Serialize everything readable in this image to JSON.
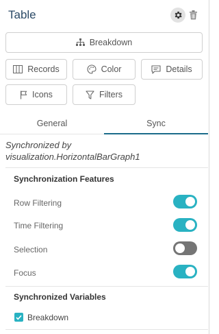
{
  "header": {
    "title": "Table"
  },
  "buttons": {
    "breakdown": "Breakdown",
    "records": "Records",
    "color": "Color",
    "details": "Details",
    "icons": "Icons",
    "filters": "Filters"
  },
  "tabs": [
    {
      "label": "General",
      "active": false
    },
    {
      "label": "Sync",
      "active": true
    }
  ],
  "sync": {
    "line1": "Synchronized by",
    "line2": "visualization.HorizontalBarGraph1"
  },
  "features": {
    "title": "Synchronization Features",
    "items": [
      {
        "label": "Row Filtering",
        "on": true
      },
      {
        "label": "Time Filtering",
        "on": true
      },
      {
        "label": "Selection",
        "on": false
      },
      {
        "label": "Focus",
        "on": true
      }
    ]
  },
  "variables": {
    "title": "Synchronized Variables",
    "items": [
      {
        "label": "Breakdown",
        "checked": true
      }
    ]
  },
  "colors": {
    "accent": "#29b2c2",
    "title": "#2b4a66",
    "toggle_off": "#757575"
  }
}
